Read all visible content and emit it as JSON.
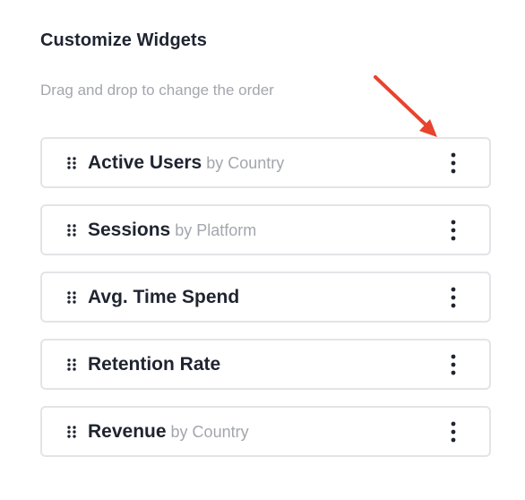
{
  "header": {
    "title": "Customize Widgets",
    "subtitle": "Drag and drop to change the order"
  },
  "widgets": [
    {
      "name": "Active Users",
      "sub": "by Country"
    },
    {
      "name": "Sessions",
      "sub": "by Platform"
    },
    {
      "name": "Avg. Time Spend",
      "sub": ""
    },
    {
      "name": "Retention Rate",
      "sub": ""
    },
    {
      "name": "Revenue",
      "sub": "by Country"
    }
  ],
  "icons": {
    "drag": "drag-handle-icon",
    "more": "more-vertical-icon"
  },
  "colors": {
    "title": "#1f2430",
    "muted": "#a3a6ac",
    "border": "#e3e4e7",
    "annotation": "#e8432d"
  }
}
